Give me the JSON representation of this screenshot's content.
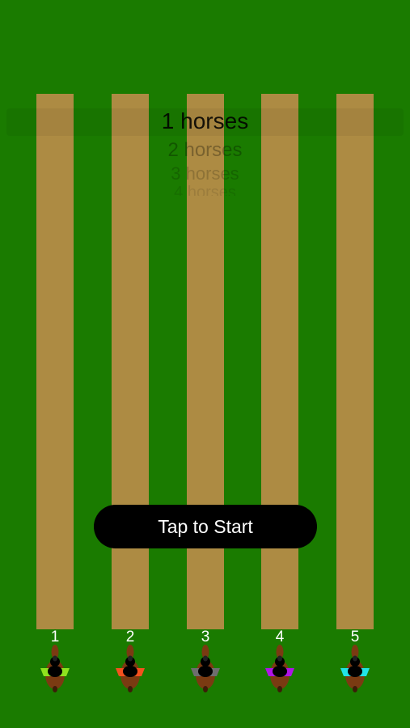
{
  "horse_count_picker": {
    "options": [
      "1 horses",
      "2 horses",
      "3 horses",
      "4 horses"
    ]
  },
  "start_button": {
    "label": "Tap to Start"
  },
  "lanes": [
    {
      "number": "1",
      "saddle_color": "#8fe21e"
    },
    {
      "number": "2",
      "saddle_color": "#f4511e"
    },
    {
      "number": "3",
      "saddle_color": "#6e6e6e"
    },
    {
      "number": "4",
      "saddle_color": "#b014e6"
    },
    {
      "number": "5",
      "saddle_color": "#22e3e6"
    }
  ],
  "colors": {
    "grass": "#1a7b00",
    "track": "#ad8b43",
    "horse_body": "#7a3b12",
    "rider": "#000000"
  }
}
